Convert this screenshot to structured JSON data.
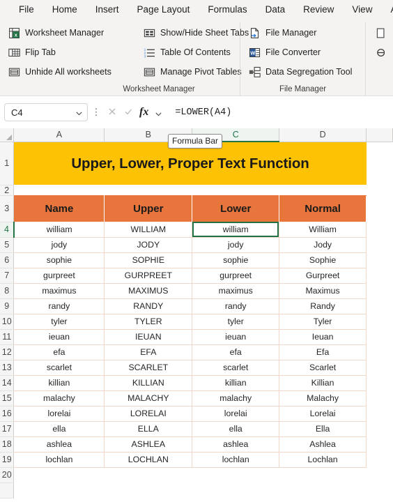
{
  "menu": {
    "tabs": [
      {
        "label": "File"
      },
      {
        "label": "Home"
      },
      {
        "label": "Insert"
      },
      {
        "label": "Page Layout"
      },
      {
        "label": "Formulas"
      },
      {
        "label": "Data"
      },
      {
        "label": "Review"
      },
      {
        "label": "View"
      },
      {
        "label": "Au"
      }
    ]
  },
  "ribbon": {
    "groups": [
      {
        "title": "Worksheet Manager",
        "items": [
          {
            "label": "Worksheet Manager",
            "icon": "worksheet-manager-icon"
          },
          {
            "label": "Flip Tab",
            "icon": "flip-tab-icon"
          },
          {
            "label": "Unhide All worksheets",
            "icon": "unhide-all-worksheets-icon"
          }
        ]
      },
      {
        "title": "",
        "items": [
          {
            "label": "Show/Hide Sheet Tabs",
            "icon": "show-hide-sheet-tabs-icon"
          },
          {
            "label": "Table Of Contents",
            "icon": "table-of-contents-icon"
          },
          {
            "label": "Manage Pivot Tables",
            "icon": "manage-pivot-tables-icon"
          }
        ]
      },
      {
        "title": "File Manager",
        "items": [
          {
            "label": "File Manager",
            "icon": "file-manager-icon"
          },
          {
            "label": "File Converter",
            "icon": "file-converter-icon"
          },
          {
            "label": "Data Segregation Tool",
            "icon": "data-segregation-tool-icon"
          }
        ]
      }
    ]
  },
  "formula_bar": {
    "name_box_value": "C4",
    "formula_value": "=LOWER(A4)",
    "cancel_icon": "cancel-icon",
    "confirm_icon": "confirm-icon",
    "function_icon": "insert-function-icon",
    "tooltip": "Formula Bar"
  },
  "sheet": {
    "columns": [
      "A",
      "B",
      "C",
      "D"
    ],
    "selected_column": "C",
    "selected_row": "4",
    "selected_cell": "C4",
    "row_numbers": [
      "1",
      "2",
      "3",
      "4",
      "5",
      "6",
      "7",
      "8",
      "9",
      "10",
      "11",
      "12",
      "13",
      "14",
      "15",
      "16",
      "17",
      "18",
      "19",
      "20"
    ],
    "title_banner": "Upper, Lower, Proper Text Function",
    "headers": [
      "Name",
      "Upper",
      "Lower",
      "Normal"
    ],
    "rows": [
      {
        "row": "4",
        "name": "william",
        "upper": "WILLIAM",
        "lower": "william",
        "normal": "William"
      },
      {
        "row": "5",
        "name": "jody",
        "upper": "JODY",
        "lower": "jody",
        "normal": "Jody"
      },
      {
        "row": "6",
        "name": "sophie",
        "upper": "SOPHIE",
        "lower": "sophie",
        "normal": "Sophie"
      },
      {
        "row": "7",
        "name": "gurpreet",
        "upper": "GURPREET",
        "lower": "gurpreet",
        "normal": "Gurpreet"
      },
      {
        "row": "8",
        "name": "maximus",
        "upper": "MAXIMUS",
        "lower": "maximus",
        "normal": "Maximus"
      },
      {
        "row": "9",
        "name": "randy",
        "upper": "RANDY",
        "lower": "randy",
        "normal": "Randy"
      },
      {
        "row": "10",
        "name": "tyler",
        "upper": "TYLER",
        "lower": "tyler",
        "normal": "Tyler"
      },
      {
        "row": "11",
        "name": "ieuan",
        "upper": "IEUAN",
        "lower": "ieuan",
        "normal": "Ieuan"
      },
      {
        "row": "12",
        "name": "efa",
        "upper": "EFA",
        "lower": "efa",
        "normal": "Efa"
      },
      {
        "row": "13",
        "name": "scarlet",
        "upper": "SCARLET",
        "lower": "scarlet",
        "normal": "Scarlet"
      },
      {
        "row": "14",
        "name": "killian",
        "upper": "KILLIAN",
        "lower": "killian",
        "normal": "Killian"
      },
      {
        "row": "15",
        "name": "malachy",
        "upper": "MALACHY",
        "lower": "malachy",
        "normal": "Malachy"
      },
      {
        "row": "16",
        "name": "lorelai",
        "upper": "LORELAI",
        "lower": "lorelai",
        "normal": "Lorelai"
      },
      {
        "row": "17",
        "name": "ella",
        "upper": "ELLA",
        "lower": "ella",
        "normal": "Ella"
      },
      {
        "row": "18",
        "name": "ashlea",
        "upper": "ASHLEA",
        "lower": "ashlea",
        "normal": "Ashlea"
      },
      {
        "row": "19",
        "name": "lochlan",
        "upper": "LOCHLAN",
        "lower": "lochlan",
        "normal": "Lochlan"
      }
    ]
  },
  "colors": {
    "title_banner_bg": "#fcc203",
    "header_bg": "#e8763c",
    "selection_green": "#217346",
    "gridline": "#f0d7c8",
    "ribbon_bg": "#f4f3f2"
  }
}
